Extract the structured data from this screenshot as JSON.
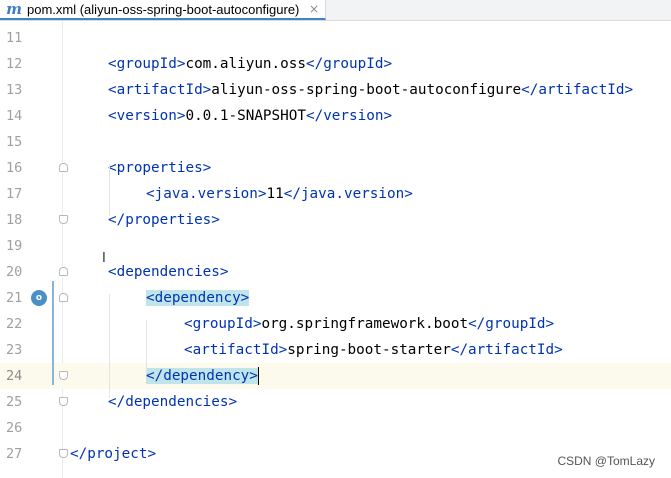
{
  "tab": {
    "icon": "maven-m-icon",
    "icon_glyph": "m",
    "label": "pom.xml (aliyun-oss-spring-boot-autoconfigure)",
    "close": "×"
  },
  "lines": [
    {
      "n": "11",
      "parts": []
    },
    {
      "n": "12",
      "parts": [
        [
          "t",
          "<groupId>"
        ],
        [
          "x",
          "com.aliyun.oss"
        ],
        [
          "t",
          "</groupId>"
        ]
      ]
    },
    {
      "n": "13",
      "parts": [
        [
          "t",
          "<artifactId>"
        ],
        [
          "x",
          "aliyun-oss-spring-boot-autoconfigure"
        ],
        [
          "t",
          "</artifactId>"
        ]
      ]
    },
    {
      "n": "14",
      "parts": [
        [
          "t",
          "<version>"
        ],
        [
          "x",
          "0.0.1-SNAPSHOT"
        ],
        [
          "t",
          "</version>"
        ]
      ]
    },
    {
      "n": "15",
      "parts": []
    },
    {
      "n": "16",
      "parts": [
        [
          "t",
          "<properties>"
        ]
      ]
    },
    {
      "n": "17",
      "parts": [
        [
          "t",
          "<java.version>"
        ],
        [
          "x",
          "11"
        ],
        [
          "t",
          "</java.version>"
        ]
      ]
    },
    {
      "n": "18",
      "parts": [
        [
          "t",
          "</properties>"
        ]
      ]
    },
    {
      "n": "19",
      "parts": []
    },
    {
      "n": "20",
      "parts": [
        [
          "t",
          "<dependencies>"
        ]
      ]
    },
    {
      "n": "21",
      "parts": [
        [
          "h",
          "<dependency>"
        ]
      ]
    },
    {
      "n": "22",
      "parts": [
        [
          "t",
          "<groupId>"
        ],
        [
          "x",
          "org.springframework.boot"
        ],
        [
          "t",
          "</groupId>"
        ]
      ]
    },
    {
      "n": "23",
      "parts": [
        [
          "t",
          "<artifactId>"
        ],
        [
          "x",
          "spring-boot-starter"
        ],
        [
          "t",
          "</artifactId>"
        ]
      ]
    },
    {
      "n": "24",
      "parts": [
        [
          "h",
          "</dependency>"
        ]
      ]
    },
    {
      "n": "25",
      "parts": [
        [
          "t",
          "</dependencies>"
        ]
      ]
    },
    {
      "n": "26",
      "parts": []
    },
    {
      "n": "27",
      "parts": [
        [
          "t",
          "</project>"
        ]
      ]
    }
  ],
  "gutter_icon": "implemented-override-icon",
  "gutter_icon_glyph": "o",
  "watermark": "CSDN @TomLazy",
  "colors": {
    "tag": "#0033b3",
    "text": "#000000",
    "match_highlight": "#bfe4ea",
    "current_line": "#fcfaed"
  }
}
